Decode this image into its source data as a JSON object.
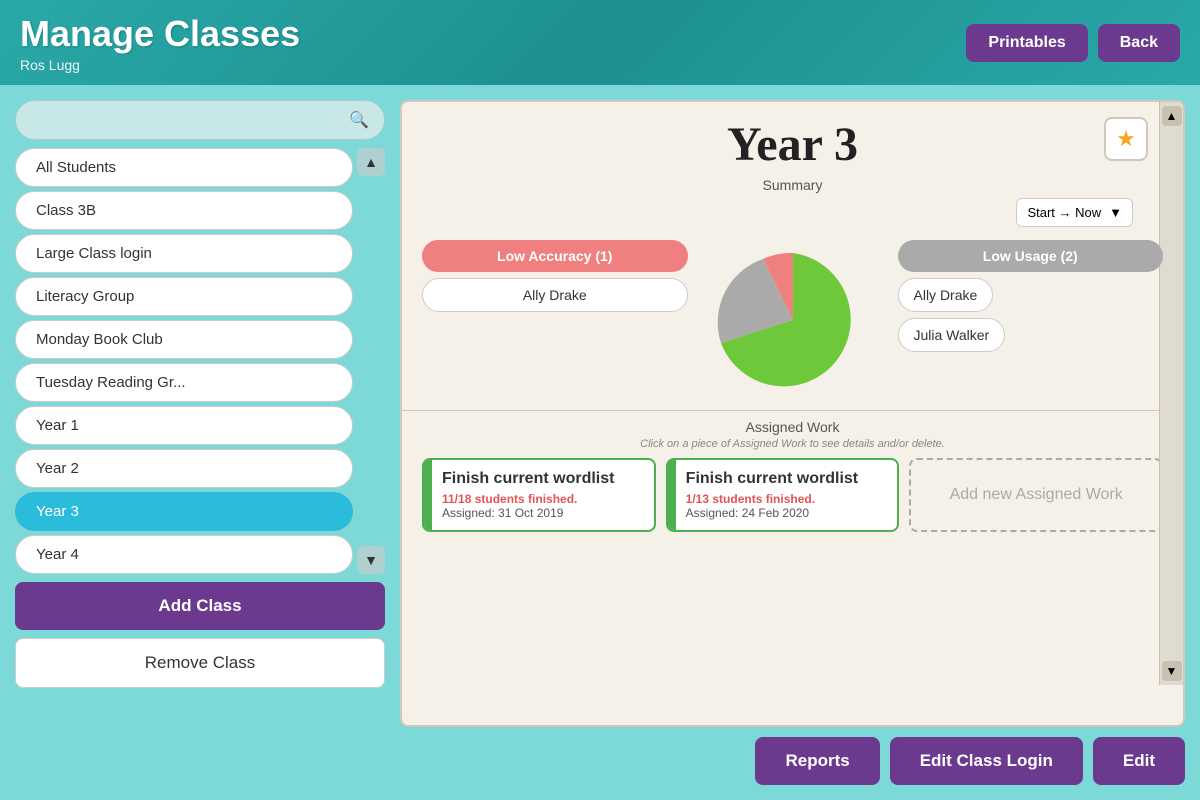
{
  "header": {
    "title": "Manage Classes",
    "user": "Ros Lugg",
    "printables_label": "Printables",
    "back_label": "Back"
  },
  "search": {
    "placeholder": ""
  },
  "classes": {
    "items": [
      {
        "id": "all-students",
        "label": "All Students",
        "active": false
      },
      {
        "id": "class-3b",
        "label": "Class 3B",
        "active": false
      },
      {
        "id": "large-class-login",
        "label": "Large Class login",
        "active": false
      },
      {
        "id": "literacy-group",
        "label": "Literacy Group",
        "active": false
      },
      {
        "id": "monday-book-club",
        "label": "Monday Book Club",
        "active": false
      },
      {
        "id": "tuesday-reading",
        "label": "Tuesday Reading Gr...",
        "active": false
      },
      {
        "id": "year-1",
        "label": "Year 1",
        "active": false
      },
      {
        "id": "year-2",
        "label": "Year 2",
        "active": false
      },
      {
        "id": "year-3",
        "label": "Year 3",
        "active": true
      },
      {
        "id": "year-4",
        "label": "Year 4",
        "active": false
      }
    ],
    "add_label": "Add Class",
    "remove_label": "Remove Class"
  },
  "detail": {
    "title": "Year 3",
    "star_icon": "★",
    "summary": {
      "label": "Summary",
      "date_range": "Start → Now",
      "low_accuracy_label": "Low Accuracy (1)",
      "low_accuracy_students": [
        "Ally Drake"
      ],
      "low_usage_label": "Low Usage (2)",
      "low_usage_students": [
        "Ally Drake",
        "Julia Walker"
      ],
      "pie": {
        "green_pct": 68,
        "red_pct": 12,
        "gray_pct": 20
      }
    },
    "assigned_work": {
      "label": "Assigned Work",
      "hint": "Click on a piece of Assigned Work to see details and/or delete.",
      "cards": [
        {
          "title": "Finish current wordlist",
          "students_finished": "11/18 students finished.",
          "assigned": "Assigned: 31 Oct 2019"
        },
        {
          "title": "Finish current wordlist",
          "students_finished": "1/13 students finished.",
          "assigned": "Assigned: 24 Feb 2020"
        }
      ],
      "add_label": "Add new Assigned Work"
    },
    "actions": {
      "reports_label": "Reports",
      "edit_class_login_label": "Edit Class Login",
      "edit_label": "Edit"
    }
  }
}
